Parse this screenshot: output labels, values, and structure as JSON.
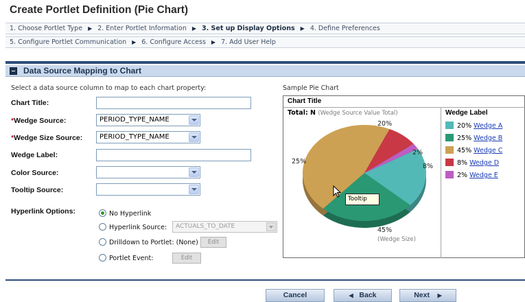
{
  "page": {
    "title": "Create Portlet Definition (Pie Chart)"
  },
  "steps": {
    "row1": [
      {
        "label": "1. Choose Portlet Type",
        "current": false
      },
      {
        "label": "2. Enter Portlet Information",
        "current": false
      },
      {
        "label": "3. Set up Display Options",
        "current": true
      },
      {
        "label": "4. Define Preferences",
        "current": false
      }
    ],
    "row2": [
      {
        "label": "5. Configure Portlet Communication",
        "current": false
      },
      {
        "label": "6. Configure Access",
        "current": false
      },
      {
        "label": "7. Add User Help",
        "current": false
      }
    ]
  },
  "section": {
    "title": "Data Source Mapping to Chart",
    "instruction": "Select a data source column to map to each chart property:"
  },
  "form": {
    "chart_title": {
      "label": "Chart Title:",
      "value": ""
    },
    "wedge_source": {
      "required_mark": "*",
      "label": "Wedge Source:",
      "value": "PERIOD_TYPE_NAME"
    },
    "wedge_size_source": {
      "required_mark": "*",
      "label": "Wedge Size Source:",
      "value": "PERIOD_TYPE_NAME"
    },
    "wedge_label": {
      "label": "Wedge Label:",
      "value": ""
    },
    "color_source": {
      "label": "Color Source:",
      "value": ""
    },
    "tooltip_source": {
      "label": "Tooltip Source:",
      "value": ""
    },
    "hyperlink": {
      "label": "Hyperlink Options:",
      "no_hyperlink": "No Hyperlink",
      "hyperlink_source": "Hyperlink Source:",
      "hyperlink_source_value": "ACTUALS_TO_DATE",
      "drilldown": "Drilldown to Portlet: (None)",
      "portlet_event": "Portlet Event:",
      "edit": "Edit",
      "selected": "no_hyperlink"
    }
  },
  "sample": {
    "heading": "Sample Pie Chart",
    "chart_title": "Chart Title",
    "total": "Total: N",
    "total_note": "(Wedge Source Value Total)",
    "legend_title": "Wedge Label",
    "tooltip": "Tooltip",
    "wedge_size_note": "(Wedge Size)"
  },
  "chart_data": {
    "type": "pie",
    "title": "Chart Title",
    "slices": [
      {
        "label": "Wedge A",
        "value": 20,
        "display": "20%",
        "color": "#52b9b7"
      },
      {
        "label": "Wedge B",
        "value": 25,
        "display": "25%",
        "color": "#2a9873"
      },
      {
        "label": "Wedge C",
        "value": 45,
        "display": "45%",
        "color": "#cda153"
      },
      {
        "label": "Wedge D",
        "value": 8,
        "display": "8%",
        "color": "#c83945"
      },
      {
        "label": "Wedge E",
        "value": 2,
        "display": "2%",
        "color": "#bc5ec1"
      }
    ],
    "legend_position": "right"
  },
  "buttons": {
    "cancel": "Cancel",
    "back": "Back",
    "next": "Next"
  },
  "colors": {
    "accent": "#2d4e7b",
    "required": "#c0152f",
    "link": "#1a3bb5"
  }
}
